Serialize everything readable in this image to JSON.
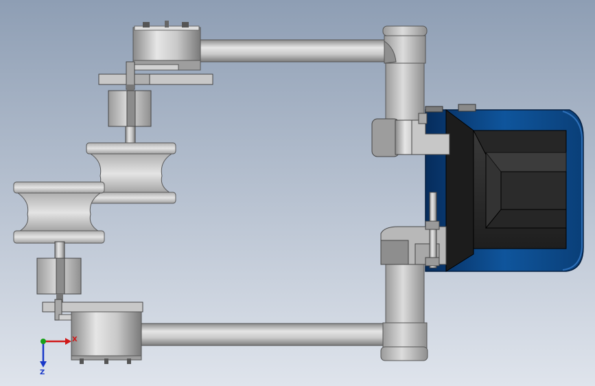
{
  "colors": {
    "background_top": "#8e9eb4",
    "background_bottom": "#dfe4ec",
    "metal_light": "#e0e0e0",
    "metal_mid": "#b9b9b9",
    "metal_dark": "#7d7d7d",
    "edge": "#4a4a4a",
    "motor_blue": "#0d4a8c",
    "motor_blue_dark": "#062c5c",
    "motor_black": "#2a2a2a",
    "axis_x": "#d01818",
    "axis_y": "#18a018",
    "axis_z": "#1838c8"
  },
  "triad": {
    "x_label": "X",
    "z_label": "Z"
  },
  "icons": {
    "triad": "coordinate-triad-icon"
  }
}
